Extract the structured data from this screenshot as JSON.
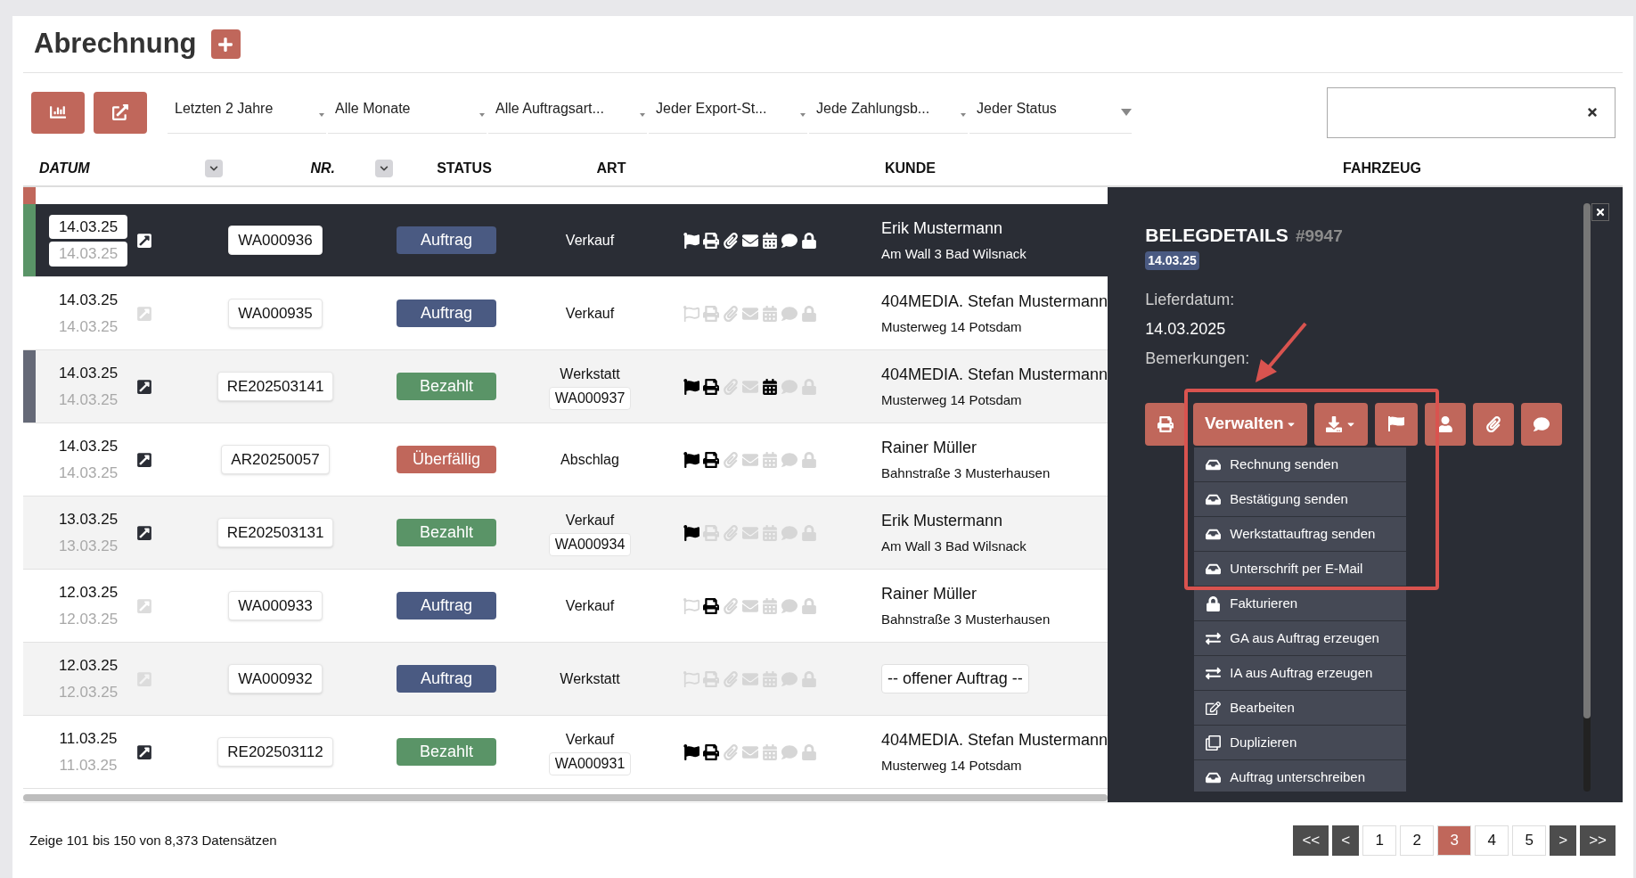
{
  "title": "Abrechnung",
  "filters": [
    "Letzten 2 Jahre",
    "Alle Monate",
    "Alle Auftragsart...",
    "Jeder Export-St...",
    "Jede Zahlungsb...",
    "Jeder Status"
  ],
  "columns": [
    {
      "label": "DATUM",
      "sortable": true
    },
    {
      "label": "NR.",
      "sortable": true
    },
    {
      "label": "STATUS",
      "sortable": false
    },
    {
      "label": "ART",
      "sortable": false
    },
    {
      "label": "KUNDE",
      "sortable": false
    },
    {
      "label": "FAHRZEUG",
      "sortable": false
    }
  ],
  "row_above": {
    "color": "#c0675b"
  },
  "rows": [
    {
      "selected": true,
      "color": "#5a9467",
      "dates": [
        "14.03.25",
        "14.03.25"
      ],
      "link_active": true,
      "nr": "WA000936",
      "status": {
        "label": "Auftrag",
        "color": "#4a5a82"
      },
      "art": {
        "label": "Verkauf"
      },
      "icons": {
        "flag": true,
        "print": true,
        "attachment": true,
        "mail": true,
        "calendar": true,
        "comment": true,
        "lock": true
      },
      "customer": {
        "kind": "contact",
        "name": "Erik Mustermann",
        "address": "Am Wall 3 Bad Wilsnack"
      }
    },
    {
      "selected": false,
      "dates": [
        "14.03.25",
        "14.03.25"
      ],
      "link_active": false,
      "nr": "WA000935",
      "status": {
        "label": "Auftrag",
        "color": "#4a5a82"
      },
      "art": {
        "label": "Verkauf"
      },
      "icons": {
        "flag": false,
        "print": false,
        "attachment": false,
        "mail": false,
        "calendar": false,
        "comment": false,
        "lock": false
      },
      "customer": {
        "kind": "contact",
        "name": "404MEDIA. Stefan Mustermann",
        "address": "Musterweg 14 Potsdam"
      }
    },
    {
      "selected": false,
      "color": "#656977",
      "dates": [
        "14.03.25",
        "14.03.25"
      ],
      "link_active": true,
      "nr": "RE202503141",
      "status": {
        "label": "Bezahlt",
        "color": "#5a9467"
      },
      "art": {
        "label": "Werkstatt",
        "ref": "WA000937"
      },
      "icons": {
        "flag": true,
        "print": true,
        "attachment": false,
        "mail": false,
        "calendar": true,
        "comment": false,
        "lock": false
      },
      "customer": {
        "kind": "contact",
        "name": "404MEDIA. Stefan Mustermann",
        "address": "Musterweg 14 Potsdam"
      }
    },
    {
      "selected": false,
      "dates": [
        "14.03.25",
        "14.03.25"
      ],
      "link_active": true,
      "nr": "AR20250057",
      "status": {
        "label": "Überfällig",
        "color": "#c0675b"
      },
      "art": {
        "label": "Abschlag"
      },
      "icons": {
        "flag": true,
        "print": true,
        "attachment": false,
        "mail": false,
        "calendar": false,
        "comment": false,
        "lock": false
      },
      "customer": {
        "kind": "contact",
        "name": "Rainer Müller",
        "address": "Bahnstraße 3 Musterhausen"
      }
    },
    {
      "selected": false,
      "dates": [
        "13.03.25",
        "13.03.25"
      ],
      "link_active": true,
      "nr": "RE202503131",
      "status": {
        "label": "Bezahlt",
        "color": "#5a9467"
      },
      "art": {
        "label": "Verkauf",
        "ref": "WA000934"
      },
      "icons": {
        "flag": true,
        "print": false,
        "attachment": false,
        "mail": false,
        "calendar": false,
        "comment": false,
        "lock": false
      },
      "customer": {
        "kind": "contact",
        "name": "Erik Mustermann",
        "address": "Am Wall 3 Bad Wilsnack"
      }
    },
    {
      "selected": false,
      "dates": [
        "12.03.25",
        "12.03.25"
      ],
      "link_active": false,
      "nr": "WA000933",
      "status": {
        "label": "Auftrag",
        "color": "#4a5a82"
      },
      "art": {
        "label": "Verkauf"
      },
      "icons": {
        "flag": false,
        "print": true,
        "attachment": false,
        "mail": false,
        "calendar": false,
        "comment": false,
        "lock": false
      },
      "customer": {
        "kind": "contact",
        "name": "Rainer Müller",
        "address": "Bahnstraße 3 Musterhausen"
      }
    },
    {
      "selected": false,
      "dates": [
        "12.03.25",
        "12.03.25"
      ],
      "link_active": false,
      "nr": "WA000932",
      "status": {
        "label": "Auftrag",
        "color": "#4a5a82"
      },
      "art": {
        "label": "Werkstatt"
      },
      "icons": {
        "flag": false,
        "print": false,
        "attachment": false,
        "mail": false,
        "calendar": false,
        "comment": false,
        "lock": false
      },
      "customer": {
        "kind": "open",
        "name": "-- offener Auftrag --"
      }
    },
    {
      "selected": false,
      "dates": [
        "11.03.25",
        "11.03.25"
      ],
      "link_active": true,
      "nr": "RE202503112",
      "status": {
        "label": "Bezahlt",
        "color": "#5a9467"
      },
      "art": {
        "label": "Verkauf",
        "ref": "WA000931"
      },
      "icons": {
        "flag": true,
        "print": true,
        "attachment": false,
        "mail": false,
        "calendar": false,
        "comment": false,
        "lock": false
      },
      "customer": {
        "kind": "contact",
        "name": "404MEDIA. Stefan Mustermann",
        "address": "Musterweg 14 Potsdam"
      }
    }
  ],
  "panel": {
    "title": "BELEGDETAILS",
    "number": "#9947",
    "date": "14.03.25",
    "fields": [
      {
        "label": "Lieferdatum:",
        "value": "14.03.2025"
      },
      {
        "label": "Bemerkungen:"
      }
    ],
    "buttons": [
      {
        "kind": "print"
      },
      {
        "kind": "menu",
        "label": "Verwalten"
      },
      {
        "kind": "download"
      },
      {
        "kind": "flag"
      },
      {
        "kind": "person"
      },
      {
        "kind": "attachment"
      },
      {
        "kind": "comment"
      }
    ],
    "menu": [
      {
        "kind": "inbox",
        "label": "Rechnung senden"
      },
      {
        "kind": "inbox",
        "label": "Bestätigung senden"
      },
      {
        "kind": "inbox",
        "label": "Werkstattauftrag senden"
      },
      {
        "kind": "inbox",
        "label": "Unterschrift per E-Mail"
      },
      {
        "kind": "lock",
        "label": "Fakturieren"
      },
      {
        "kind": "exchange",
        "label": "GA aus Auftrag erzeugen"
      },
      {
        "kind": "exchange",
        "label": "IA aus Auftrag erzeugen"
      },
      {
        "kind": "edit",
        "label": "Bearbeiten"
      },
      {
        "kind": "copy",
        "label": "Duplizieren"
      },
      {
        "kind": "inbox",
        "label": "Auftrag unterschreiben"
      }
    ]
  },
  "footer": "Zeige 101 bis 150 von 8,373 Datensätzen",
  "pagination": [
    {
      "label": "<<",
      "kind": "nav",
      "selected": false
    },
    {
      "label": "<",
      "kind": "nav",
      "selected": false
    },
    {
      "label": "1",
      "kind": "page",
      "selected": false
    },
    {
      "label": "2",
      "kind": "page",
      "selected": false
    },
    {
      "label": "3",
      "kind": "page",
      "selected": true
    },
    {
      "label": "4",
      "kind": "page",
      "selected": false
    },
    {
      "label": "5",
      "kind": "page",
      "selected": false
    },
    {
      "label": ">",
      "kind": "nav",
      "selected": false
    },
    {
      "label": ">>",
      "kind": "nav",
      "selected": false
    }
  ]
}
